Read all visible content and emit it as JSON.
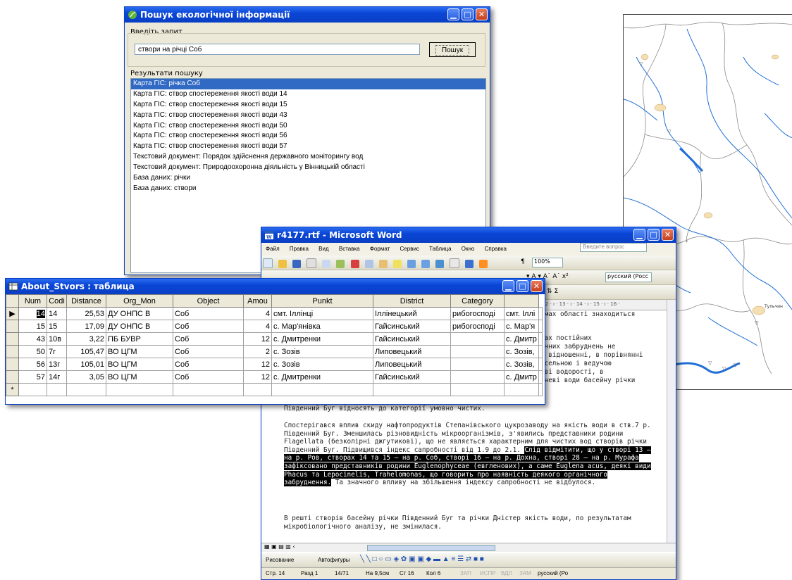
{
  "search_window": {
    "title": "Пошук екологічної інформації",
    "query_label": "Введіть запит",
    "query_value": "створи на річці Соб",
    "search_button": "Пошук",
    "results_label": "Результати пошуку",
    "results": [
      "Карта ГІС: річка Соб",
      "Карта ГІС: створ спостереження якості води 14",
      "Карта ГІС: створ спостереження якості води 15",
      "Карта ГІС: створ спостереження якості води 43",
      "Карта ГІС: створ спостереження якості води 50",
      "Карта ГІС: створ спостереження якості води 56",
      "Карта ГІС: створ спостереження якості води 57",
      "Текстовий документ: Порядок здійснення державного моніторингу вод",
      "Текстовий документ: Природоохоронна діяльність у Вінницькій області",
      "База даних: річки",
      "База даних: створи"
    ],
    "selected_index": 0
  },
  "word_window": {
    "title": "r4177.rtf - Microsoft Word",
    "menu": [
      "Файл",
      "Правка",
      "Вид",
      "Вставка",
      "Формат",
      "Сервис",
      "Таблица",
      "Окно",
      "Справка"
    ],
    "help_placeholder": "Введите вопрос",
    "zoom": "100%",
    "font_name": "русский (Росс",
    "ruler_text": "· 12 · ı · 13 · ı · 14 · ı · 15 · ı · 16 ·",
    "right_fragments": [
      "ймах області знаходиться",
      "рах постійних",
      "ачних забруднень не",
      "у відношенні, в порівнянні",
      "исельною і ведучою",
      "ові водорості, в",
      "хневі води басейну річки"
    ],
    "para_cut": "Південний Буг відносять до категорії умовно чистих.",
    "para_main_plain": "Спостерігався вплив скиду нафтопродуктів Степанівського цукрозаводу на якість води в ств.7 р. Південний Буг. Зменшилась різновидність мікроорганізмів, з'явились представники родини Flagellata (безколірні джгутикові), що не являється характерним для чистих вод створів річки Південний Буг. Підвищився індекс сапробності від 1.9 до 2.1.",
    "para_main_highlight": "Слід відмітити, що у створі 13 – на р. Ров, створах 14 та 15 – на р. Соб, створі 16 – на р. Дохна, створі 28 – на р. Мурафа зафіксовано представників родини Euglenophyceae (евгленових), а саме Euglena acus, деякі види Phacus та Lepocinelis, Trahelomonas, що говорить про наявність деякого органічного забруднення.",
    "para_main_tail": "Та значного впливу на збільшення індексу сапробності не відбулося.",
    "para_last": "В решті створів басейну річки Південний Буг та річки Дністер якість води, по результатам мікробіологічного аналізу, не змінилася.",
    "draw_label": "Рисование",
    "autoshapes_label": "Автофигуры",
    "status": {
      "page": "Стр. 14",
      "section": "Разд 1",
      "pages": "14/71",
      "at": "На 9,5см",
      "line": "Ст 16",
      "col": "Кол 6",
      "rec": "ЗАП",
      "trk": "ИСПР",
      "ext": "ВДЛ",
      "ovr": "ЗАМ",
      "lang": "русский (Ро"
    }
  },
  "table_window": {
    "title": "About_Stvors : таблица",
    "columns": [
      "Num",
      "Code",
      "Distance",
      "Org_Mon",
      "Object",
      "Amount",
      "Punkt",
      "District",
      "Category",
      ""
    ],
    "column_headers_visible": [
      "Num",
      "Codi",
      "Distance",
      "Org_Mon",
      "Object",
      "Amou",
      "Punkt",
      "District",
      "Category",
      ""
    ],
    "rows": [
      [
        "14",
        "14",
        "25,53",
        "ДУ ОНПС В",
        "Соб",
        "4",
        "смт. Іллінці",
        "Іллінецький",
        "рибогосподі",
        "смт. Іллі"
      ],
      [
        "15",
        "15",
        "17,09",
        "ДУ ОНПС В",
        "Соб",
        "4",
        "с. Мар'янівка",
        "Гайсинський",
        "рибогосподі",
        "с. Мар'я"
      ],
      [
        "43",
        "10в",
        "3,22",
        "ПБ БУВР",
        "Соб",
        "12",
        "с. Дмитренки",
        "Гайсинський",
        "",
        "с. Дмитр"
      ],
      [
        "50",
        "7г",
        "105,47",
        "ВО ЦГМ",
        "Соб",
        "2",
        "с. Зозів",
        "Липовецький",
        "",
        "с. Зозів,"
      ],
      [
        "56",
        "13г",
        "105,01",
        "ВО ЦГМ",
        "Соб",
        "12",
        "с. Зозів",
        "Липовецький",
        "",
        "с. Зозів,"
      ],
      [
        "57",
        "14г",
        "3,05",
        "ВО ЦГМ",
        "Соб",
        "12",
        "с. Дмитренки",
        "Гайсинський",
        "",
        "с. Дмитр"
      ]
    ],
    "new_row_marker": "*",
    "current_row_marker": "▶"
  },
  "map": {
    "river_color": "#1f6fd6",
    "boundary_color": "#8a8a8a",
    "labels": [
      "Тульчин"
    ]
  }
}
